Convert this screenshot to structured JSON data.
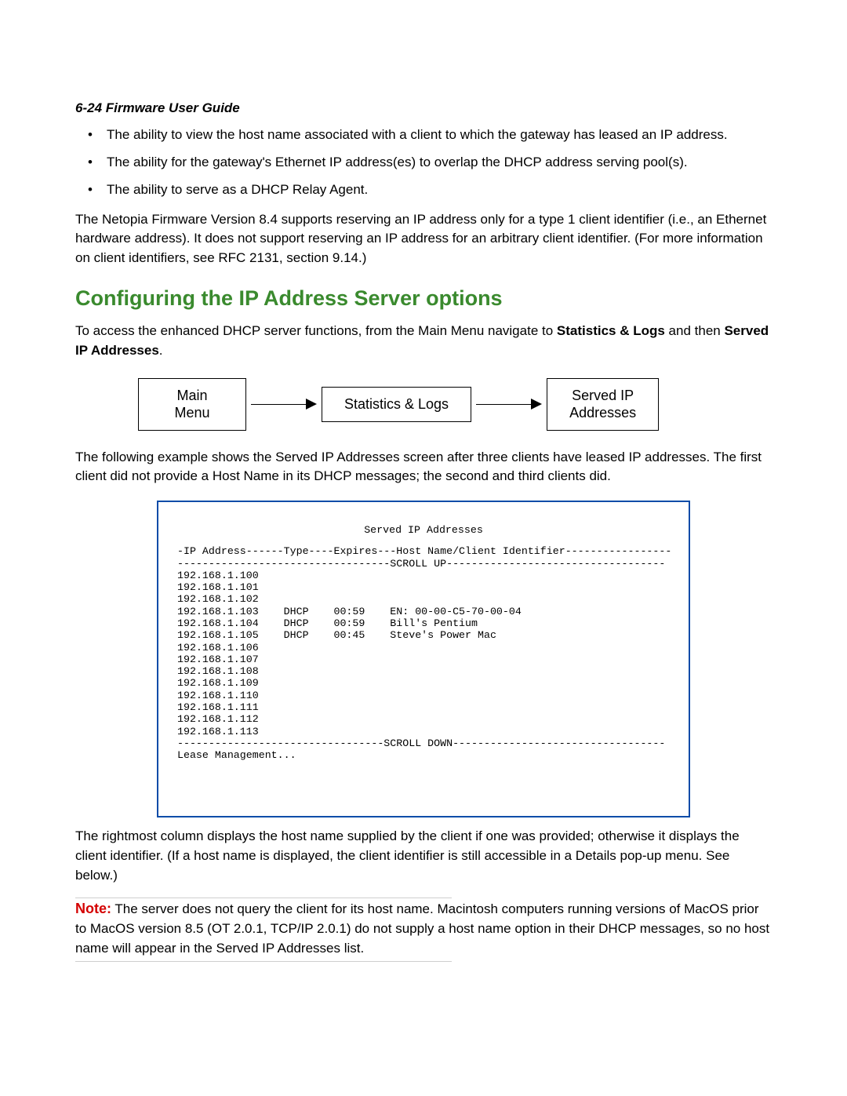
{
  "header": "6-24  Firmware User Guide",
  "bullets": [
    "The ability to view the host name associated with a client to which the gateway has leased an IP address.",
    "The ability for the gateway's Ethernet IP address(es) to overlap the DHCP address serving pool(s).",
    "The ability to serve as a DHCP Relay Agent."
  ],
  "para_support": "The Netopia Firmware Version 8.4 supports reserving an IP address only for a type 1 client identifier (i.e., an Ethernet hardware address). It does not support reserving an IP address for an arbitrary client identifier. (For more information on client identifiers, see RFC 2131, section 9.14.)",
  "section_heading": "Configuring the IP Address Server options",
  "access_para_pre": "To access the enhanced DHCP server functions, from the Main Menu navigate to ",
  "access_bold1": "Statistics & Logs",
  "access_mid": " and then ",
  "access_bold2": "Served IP Addresses",
  "access_end": ".",
  "flow": {
    "box1_line1": "Main",
    "box1_line2": "Menu",
    "box2": "Statistics & Logs",
    "box3_line1": "Served IP",
    "box3_line2": "Addresses"
  },
  "example_para": "The following example shows the Served IP Addresses screen after three clients have leased IP addresses. The first client did not provide a Host Name in its DHCP messages; the second and third clients did.",
  "terminal": {
    "title": "Served IP Addresses",
    "header_line": " -IP Address------Type----Expires---Host Name/Client Identifier-----------------",
    "scroll_up": " ----------------------------------SCROLL UP-----------------------------------",
    "rows": [
      " 192.168.1.100",
      " 192.168.1.101",
      " 192.168.1.102",
      " 192.168.1.103    DHCP    00:59    EN: 00-00-C5-70-00-04",
      " 192.168.1.104    DHCP    00:59    Bill's Pentium",
      " 192.168.1.105    DHCP    00:45    Steve's Power Mac",
      " 192.168.1.106",
      " 192.168.1.107",
      " 192.168.1.108",
      " 192.168.1.109",
      " 192.168.1.110",
      " 192.168.1.111",
      " 192.168.1.112",
      " 192.168.1.113"
    ],
    "scroll_down": " ---------------------------------SCROLL DOWN----------------------------------",
    "lease": " Lease Management..."
  },
  "rightmost_para": "The rightmost column displays the host name supplied by the client if one was provided; otherwise it displays the client identifier. (If a host name is displayed, the client identifier is still accessible in a Details pop-up menu. See below.)",
  "note_label": "Note:",
  "note_text": "  The server does not query the client for its host name. Macintosh computers running versions of MacOS prior to MacOS version 8.5 (OT 2.0.1, TCP/IP 2.0.1) do not supply a host name option in their DHCP messages, so no host name will appear in the Served IP Addresses list."
}
